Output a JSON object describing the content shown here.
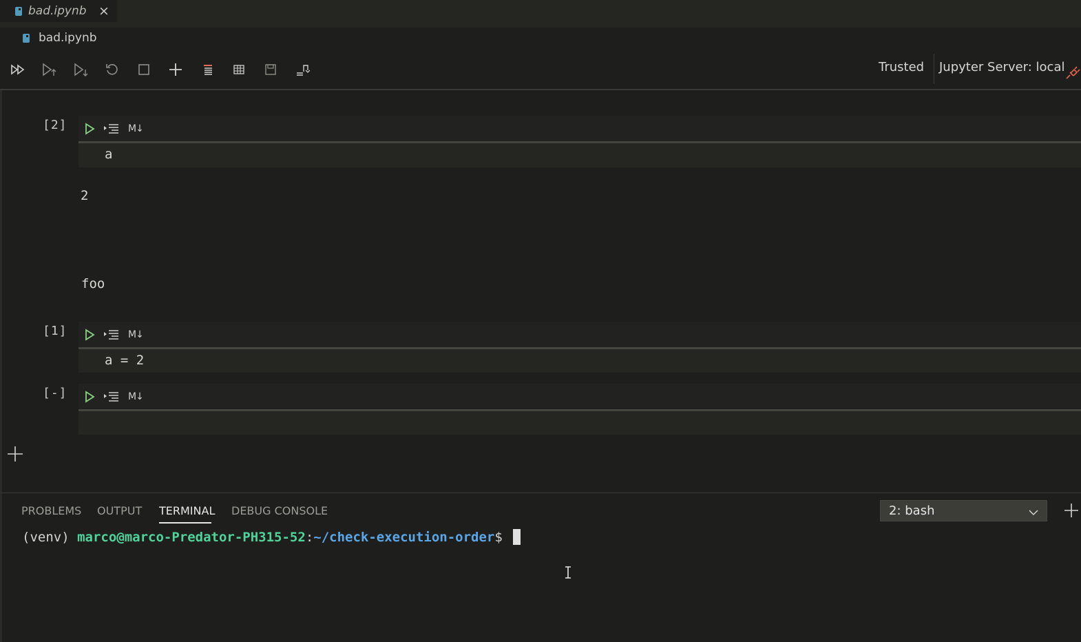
{
  "tab": {
    "title": "bad.ipynb",
    "close_glyph": "×"
  },
  "breadcrumb": {
    "file": "bad.ipynb"
  },
  "toolbar": {
    "buttons": [
      "run-all-icon",
      "run-above-icon",
      "run-below-icon",
      "restart-icon",
      "interrupt-icon",
      "add-cell-icon",
      "clear-outputs-icon",
      "variables-icon",
      "save-icon",
      "export-icon"
    ],
    "trusted_label": "Trusted",
    "server_label": "Jupyter Server: local"
  },
  "cells": [
    {
      "prompt": "[2]",
      "code": "a",
      "md_label": "M↓",
      "outputs": [
        "2",
        "foo"
      ]
    },
    {
      "prompt": "[1]",
      "code": "a = 2",
      "md_label": "M↓",
      "outputs": []
    },
    {
      "prompt": "[-]",
      "code": "",
      "md_label": "M↓",
      "outputs": []
    }
  ],
  "panel": {
    "tabs": [
      "PROBLEMS",
      "OUTPUT",
      "TERMINAL",
      "DEBUG CONSOLE"
    ],
    "active_tab": "TERMINAL",
    "terminal_select": "2: bash"
  },
  "terminal": {
    "venv": "(venv) ",
    "user_host": "marco@marco-Predator-PH315-52",
    "colon": ":",
    "path": "~/check-execution-order",
    "dollar": "$ "
  },
  "colors": {
    "accent_green": "#4ed39a",
    "accent_blue": "#5aa6e8",
    "run_green": "#89d185",
    "plug_red": "#e9654f"
  }
}
